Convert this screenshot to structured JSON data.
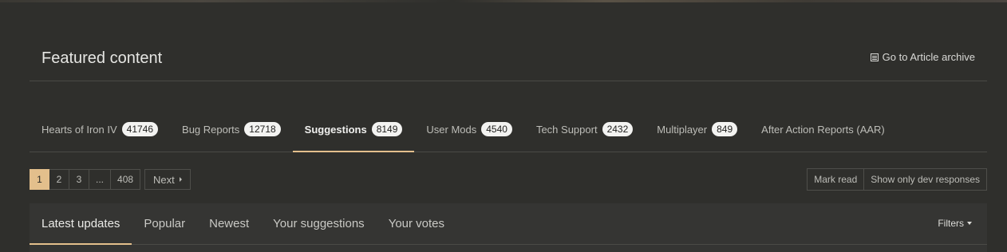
{
  "featured": {
    "title": "Featured content",
    "archive_link": "Go to Article archive",
    "archive_icon": "archive-icon"
  },
  "forum_tabs": [
    {
      "label": "Hearts of Iron IV",
      "count": "41746",
      "active": false
    },
    {
      "label": "Bug Reports",
      "count": "12718",
      "active": false
    },
    {
      "label": "Suggestions",
      "count": "8149",
      "active": true
    },
    {
      "label": "User Mods",
      "count": "4540",
      "active": false
    },
    {
      "label": "Tech Support",
      "count": "2432",
      "active": false
    },
    {
      "label": "Multiplayer",
      "count": "849",
      "active": false
    },
    {
      "label": "After Action Reports (AAR)",
      "count": null,
      "active": false
    }
  ],
  "pagination": {
    "pages": [
      "1",
      "2",
      "3",
      "...",
      "408"
    ],
    "current": "1",
    "next_label": "Next"
  },
  "actions": {
    "mark_read": "Mark read",
    "dev_responses": "Show only dev responses"
  },
  "subnav": {
    "tabs": [
      "Latest updates",
      "Popular",
      "Newest",
      "Your suggestions",
      "Your votes"
    ],
    "active": "Latest updates",
    "filters_label": "Filters"
  },
  "colors": {
    "background": "#2f2f2c",
    "accent": "#e3bf8c",
    "badge_bg": "#f3f3f1"
  }
}
